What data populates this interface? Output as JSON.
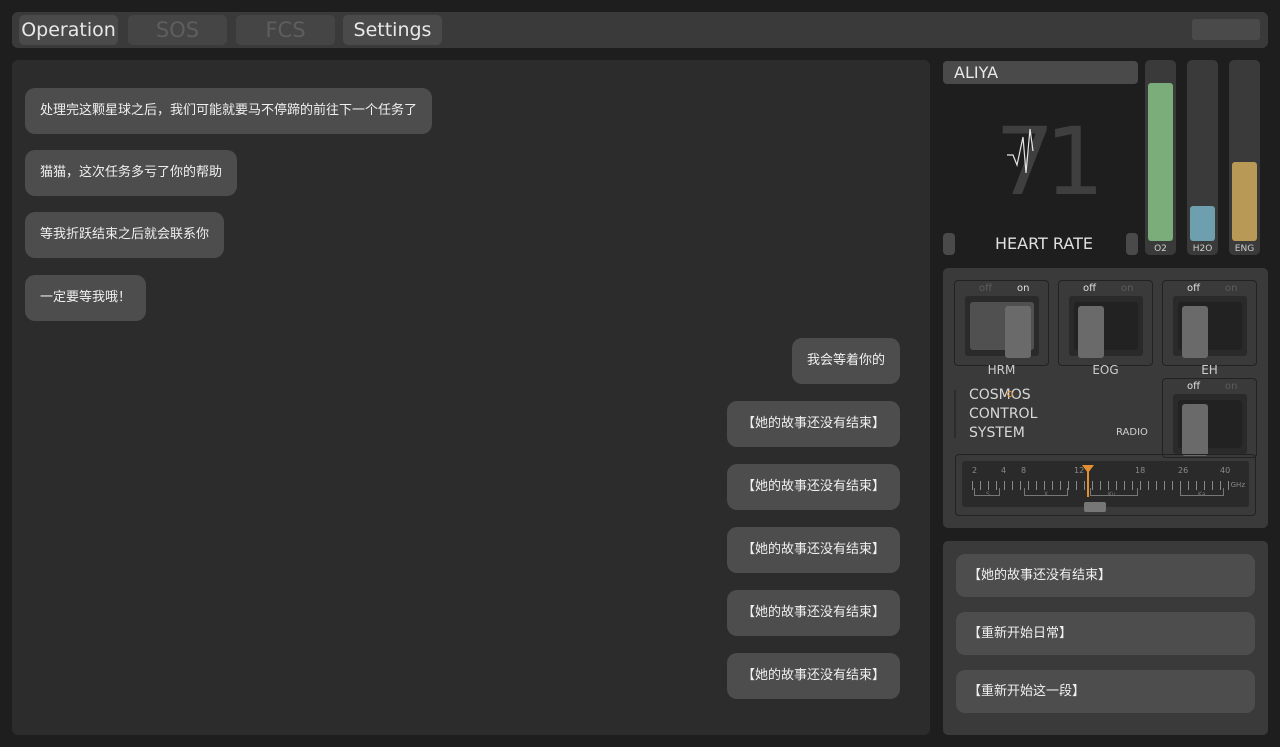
{
  "tabs": [
    {
      "label": "Operation",
      "active": true
    },
    {
      "label": "SOS",
      "active": false
    },
    {
      "label": "FCS",
      "active": false
    },
    {
      "label": "Settings",
      "active": true
    }
  ],
  "chat": {
    "incoming": [
      "处理完这颗星球之后，我们可能就要马不停蹄的前往下一个任务了",
      "猫猫，这次任务多亏了你的帮助",
      "等我折跃结束之后就会联系你",
      "一定要等我哦！"
    ],
    "outgoing": [
      "我会等着你的",
      "【她的故事还没有结束】",
      "【她的故事还没有结束】",
      "【她的故事还没有结束】",
      "【她的故事还没有结束】",
      "【她的故事还没有结束】"
    ]
  },
  "vitals": {
    "name": "ALIYA",
    "heart_rate": "71",
    "heart_rate_label": "HEART RATE",
    "gauges": [
      {
        "label": "O2",
        "level": 0.9,
        "color": "#7aad7a"
      },
      {
        "label": "H2O",
        "level": 0.2,
        "color": "#6d9fae"
      },
      {
        "label": "ENG",
        "level": 0.45,
        "color": "#b89a56"
      }
    ]
  },
  "controls": {
    "switches": [
      {
        "label": "HRM",
        "off": "off",
        "on": "on",
        "state": "on"
      },
      {
        "label": "EOG",
        "off": "off",
        "on": "on",
        "state": "off"
      },
      {
        "label": "EH",
        "off": "off",
        "on": "on",
        "state": "off"
      },
      {
        "label": "RADIO",
        "off": "off",
        "on": "on",
        "state": "off"
      }
    ],
    "system_line1": "COSMOS",
    "system_line2": "CONTROL",
    "system_line3": "SYSTEM",
    "radio_label": "RADIO",
    "freq_ticks": [
      "2",
      "4",
      "8",
      "12",
      "18",
      "26",
      "40"
    ],
    "freq_unit": "GHz",
    "bands": [
      "S",
      "X",
      "Ku",
      "Ka"
    ]
  },
  "options": [
    "【她的故事还没有结束】",
    "【重新开始日常】",
    "【重新开始这一段】"
  ],
  "accent": "#e09030"
}
